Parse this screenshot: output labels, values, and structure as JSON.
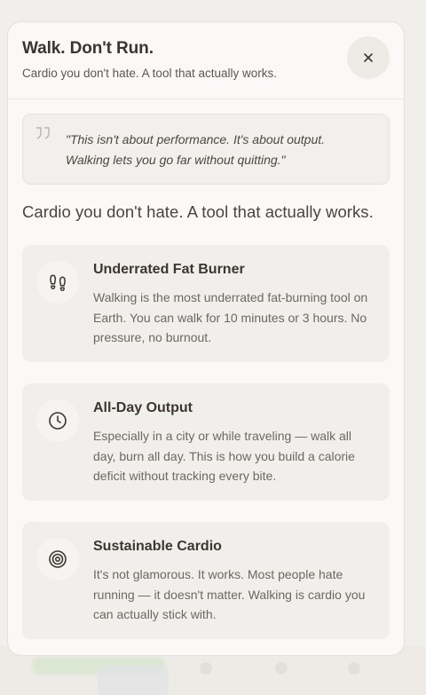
{
  "sheet": {
    "title": "Walk. Don't Run.",
    "subtitle": "Cardio you don't hate. A tool that actually works.",
    "close_icon": "close-icon"
  },
  "quote": {
    "icon": "quote-icon",
    "line1": "\"This isn't about performance. It's about output.",
    "line2": "Walking lets you go far without quitting.\""
  },
  "lead": "Cardio you don't hate. A tool that actually works.",
  "cards": [
    {
      "icon": "footprints-icon",
      "title": "Underrated Fat Burner",
      "body": "Walking is the most underrated fat-burning tool on Earth. You can walk for 10 minutes or 3 hours. No pressure, no burnout."
    },
    {
      "icon": "clock-icon",
      "title": "All-Day Output",
      "body": "Especially in a city or while traveling — walk all day, burn all day. This is how you build a calorie deficit without tracking every bite."
    },
    {
      "icon": "target-icon",
      "title": "Sustainable Cardio",
      "body": "It's not glamorous. It works. Most people hate running — it doesn't matter. Walking is cardio you can actually stick with."
    }
  ],
  "colors": {
    "background": "#f1efec",
    "sheet": "#faf9f7",
    "card": "#f1efec",
    "title": "#3b332e",
    "body": "#6e6760"
  }
}
